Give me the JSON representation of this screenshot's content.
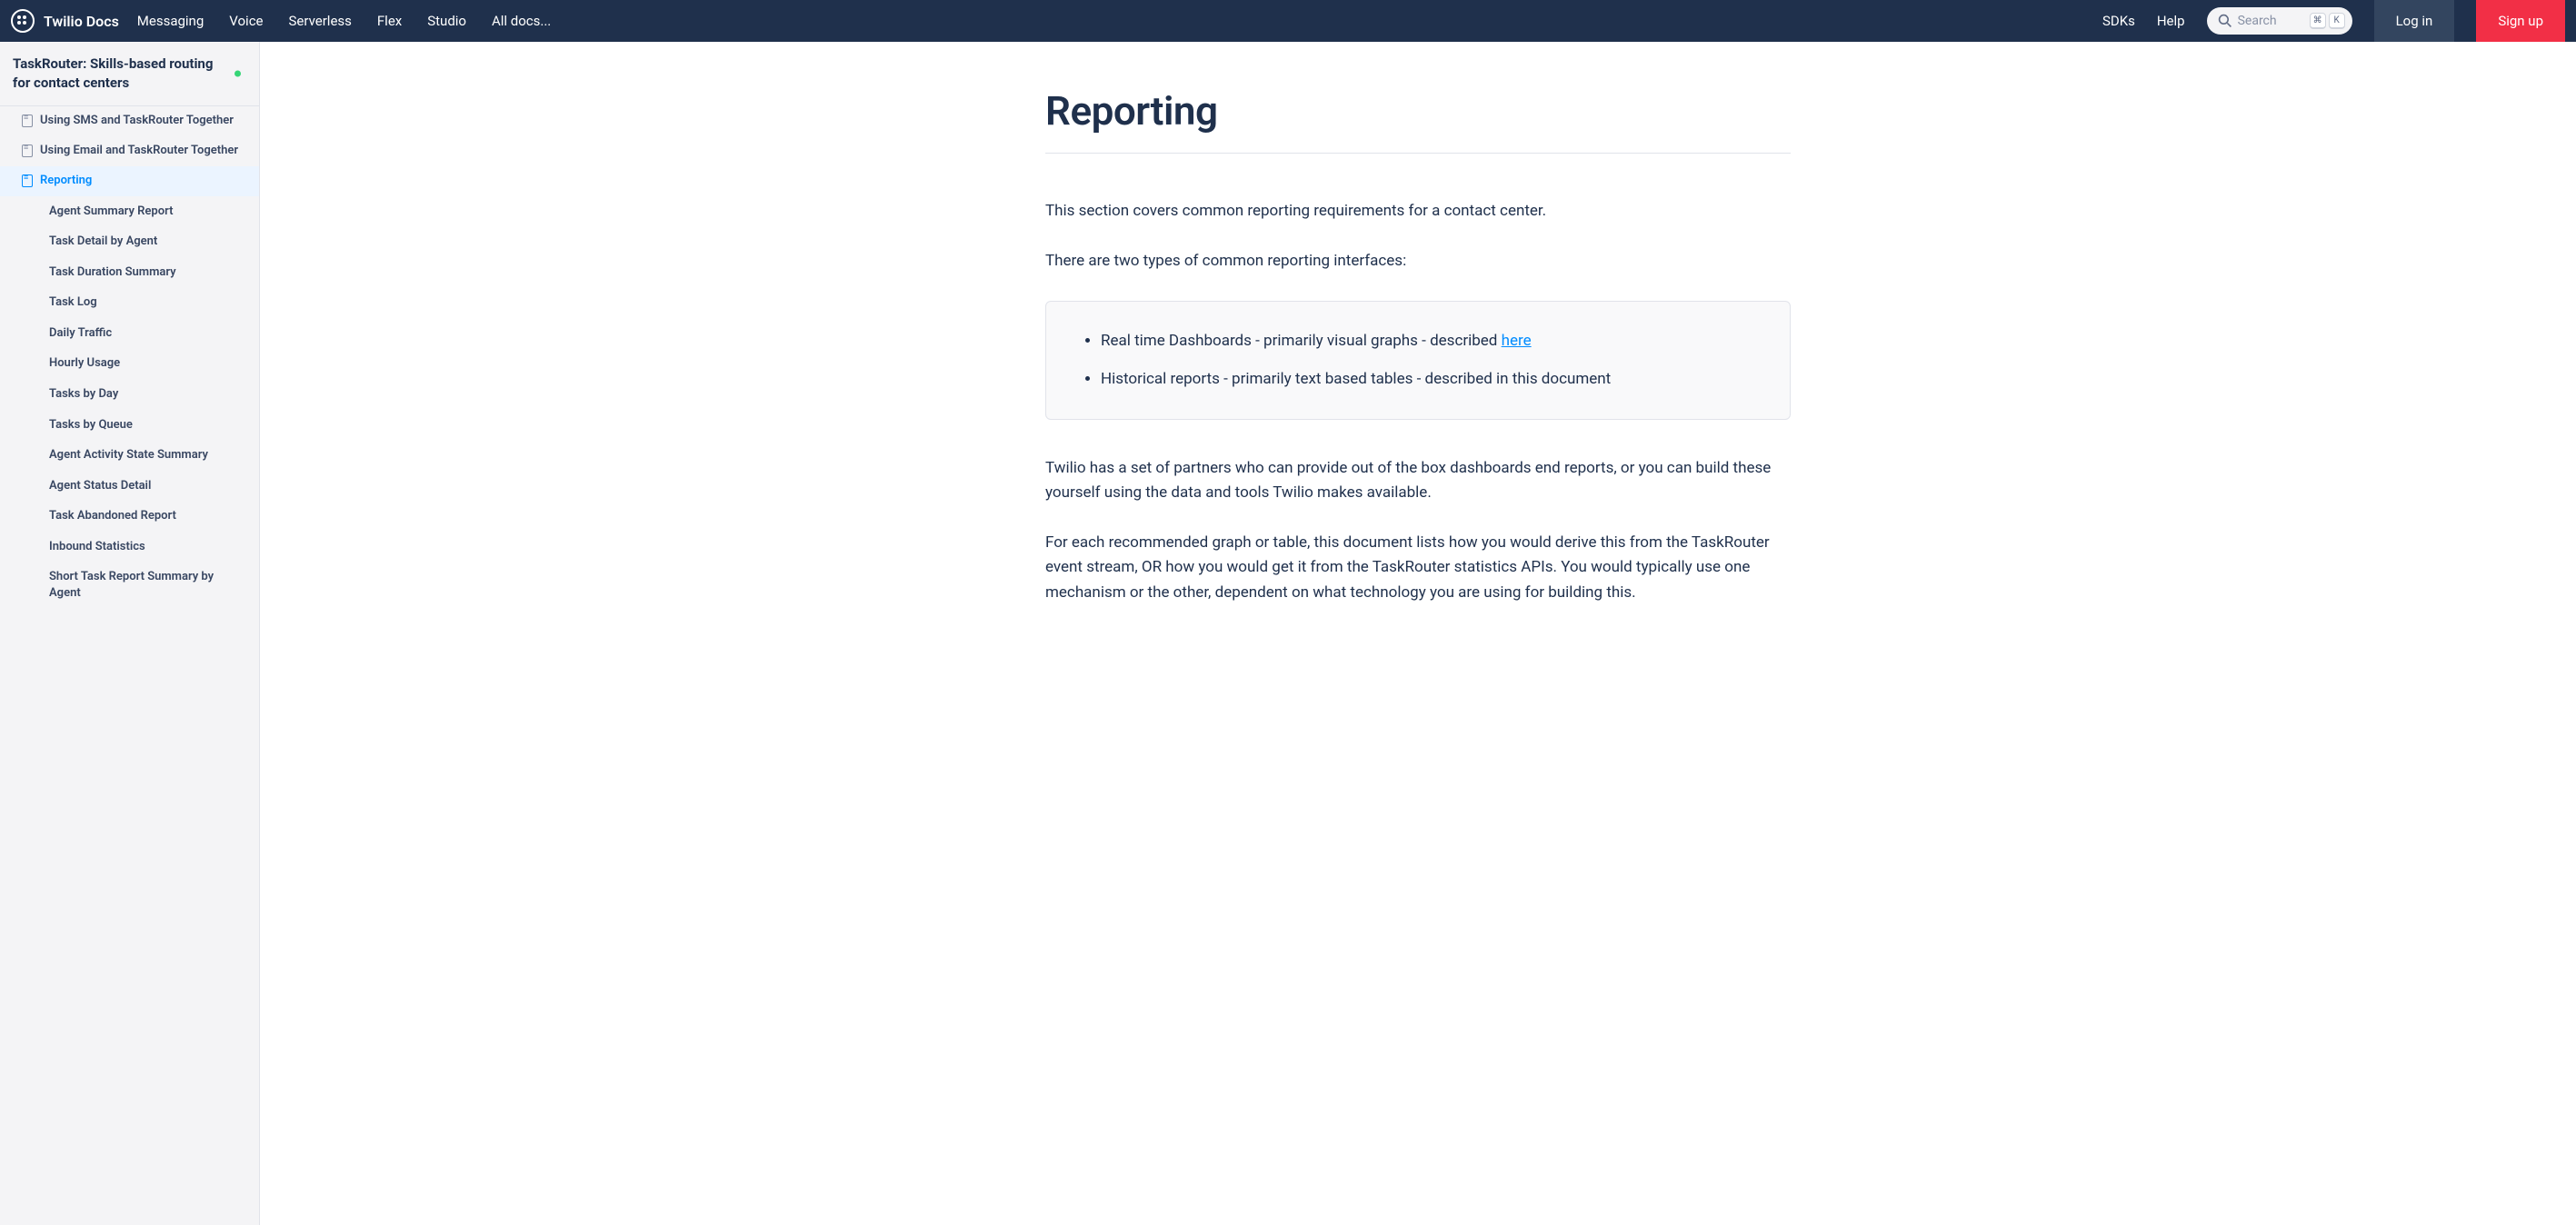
{
  "brand": "Twilio Docs",
  "nav": {
    "links": [
      "Messaging",
      "Voice",
      "Serverless",
      "Flex",
      "Studio",
      "All docs..."
    ],
    "right": [
      "SDKs",
      "Help"
    ],
    "search_placeholder": "Search",
    "key1": "⌘",
    "key2": "K",
    "login": "Log in",
    "signup": "Sign up"
  },
  "sidebar": {
    "title": "TaskRouter: Skills-based routing for contact centers",
    "items": [
      {
        "label": "Using SMS and TaskRouter Together",
        "active": false
      },
      {
        "label": "Using Email and TaskRouter Together",
        "active": false
      },
      {
        "label": "Reporting",
        "active": true
      }
    ],
    "subitems": [
      "Agent Summary Report",
      "Task Detail by Agent",
      "Task Duration Summary",
      "Task Log",
      "Daily Traffic",
      "Hourly Usage",
      "Tasks by Day",
      "Tasks by Queue",
      "Agent Activity State Summary",
      "Agent Status Detail",
      "Task Abandoned Report",
      "Inbound Statistics",
      "Short Task Report Summary by Agent"
    ]
  },
  "content": {
    "title": "Reporting",
    "p1": "This section covers common reporting requirements for a contact center.",
    "p2": "There are two types of common reporting interfaces:",
    "bullet1_pre": "Real time Dashboards - primarily visual graphs - described ",
    "bullet1_link": "here",
    "bullet2": "Historical reports - primarily text based tables - described in this document",
    "p3": "Twilio has a set of partners who can provide out of the box dashboards end reports, or you can build these yourself using the data and tools Twilio makes available.",
    "p4": "For each recommended graph or table, this document lists how you would derive this from the TaskRouter event stream, OR how you would get it from the TaskRouter statistics APIs. You would typically use one mechanism or the other, dependent on what technology you are using for building this."
  }
}
